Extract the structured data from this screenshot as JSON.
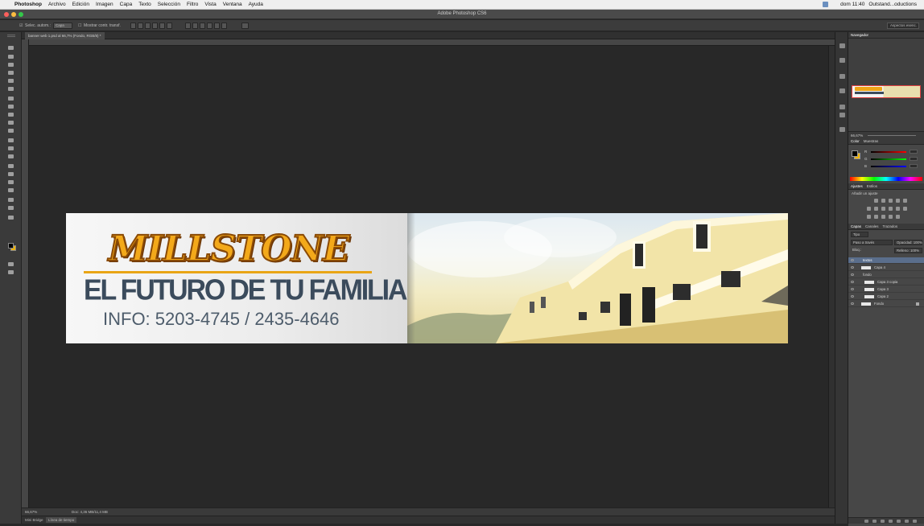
{
  "menubar": {
    "app_name": "Photoshop",
    "items": [
      "Archivo",
      "Edición",
      "Imagen",
      "Capa",
      "Texto",
      "Selección",
      "Filtro",
      "Vista",
      "Ventana",
      "Ayuda"
    ],
    "clock": "dom 11:40",
    "user": "Outstand...oductions"
  },
  "window": {
    "title": "Adobe Photoshop CS6"
  },
  "options": {
    "label1": "Selec. autom.:",
    "dropdown": "Capa",
    "label2": "Mostrar contr. transf.",
    "workspace": "Aspectos esenc."
  },
  "document": {
    "tab_label": "banner web 1.psd al 66,7% (Fondo, RGB/8) *",
    "zoom": "66,67%",
    "doc_info": "Doc: 4,36 MB/11,4 MB"
  },
  "timeline": {
    "label": "Mini Bridge",
    "tab": "Línea de tiempo"
  },
  "banner": {
    "brand": "MILLSTONE",
    "tagline": "EL FUTURO DE TU FAMILIA",
    "info": "INFO: 5203-4745 / 2435-4646",
    "brand_color": "#f3a91a",
    "text_color": "#3b4b5c"
  },
  "panels": {
    "navigator_tab": "Navegador",
    "nav_zoom": "66,67%",
    "color_tabs": [
      "Color",
      "Muestras"
    ],
    "color_rows": [
      "R",
      "G",
      "B"
    ],
    "adjust_tabs": [
      "Ajustes",
      "Estilos"
    ],
    "adjust_label": "Añadir un ajuste",
    "layers_tabs": [
      "Capas",
      "Canales",
      "Trazados"
    ],
    "filter": "Tipo",
    "blend": "Paso a través",
    "opacity": "Opacidad: 100%",
    "lock": "Bloq.:",
    "fill": "Relleno: 100%",
    "layers": [
      {
        "name": "textos",
        "selected": true,
        "folder": true,
        "indent": 0
      },
      {
        "name": "Capa 4",
        "selected": false,
        "folder": false,
        "indent": 1
      },
      {
        "name": "fondo",
        "selected": false,
        "folder": true,
        "indent": 0
      },
      {
        "name": "Capa 3 copia",
        "selected": false,
        "folder": false,
        "indent": 1
      },
      {
        "name": "Capa 3",
        "selected": false,
        "folder": false,
        "indent": 1
      },
      {
        "name": "Capa 2",
        "selected": false,
        "folder": false,
        "indent": 1
      },
      {
        "name": "Fondo",
        "selected": false,
        "folder": false,
        "indent": 0
      }
    ]
  }
}
